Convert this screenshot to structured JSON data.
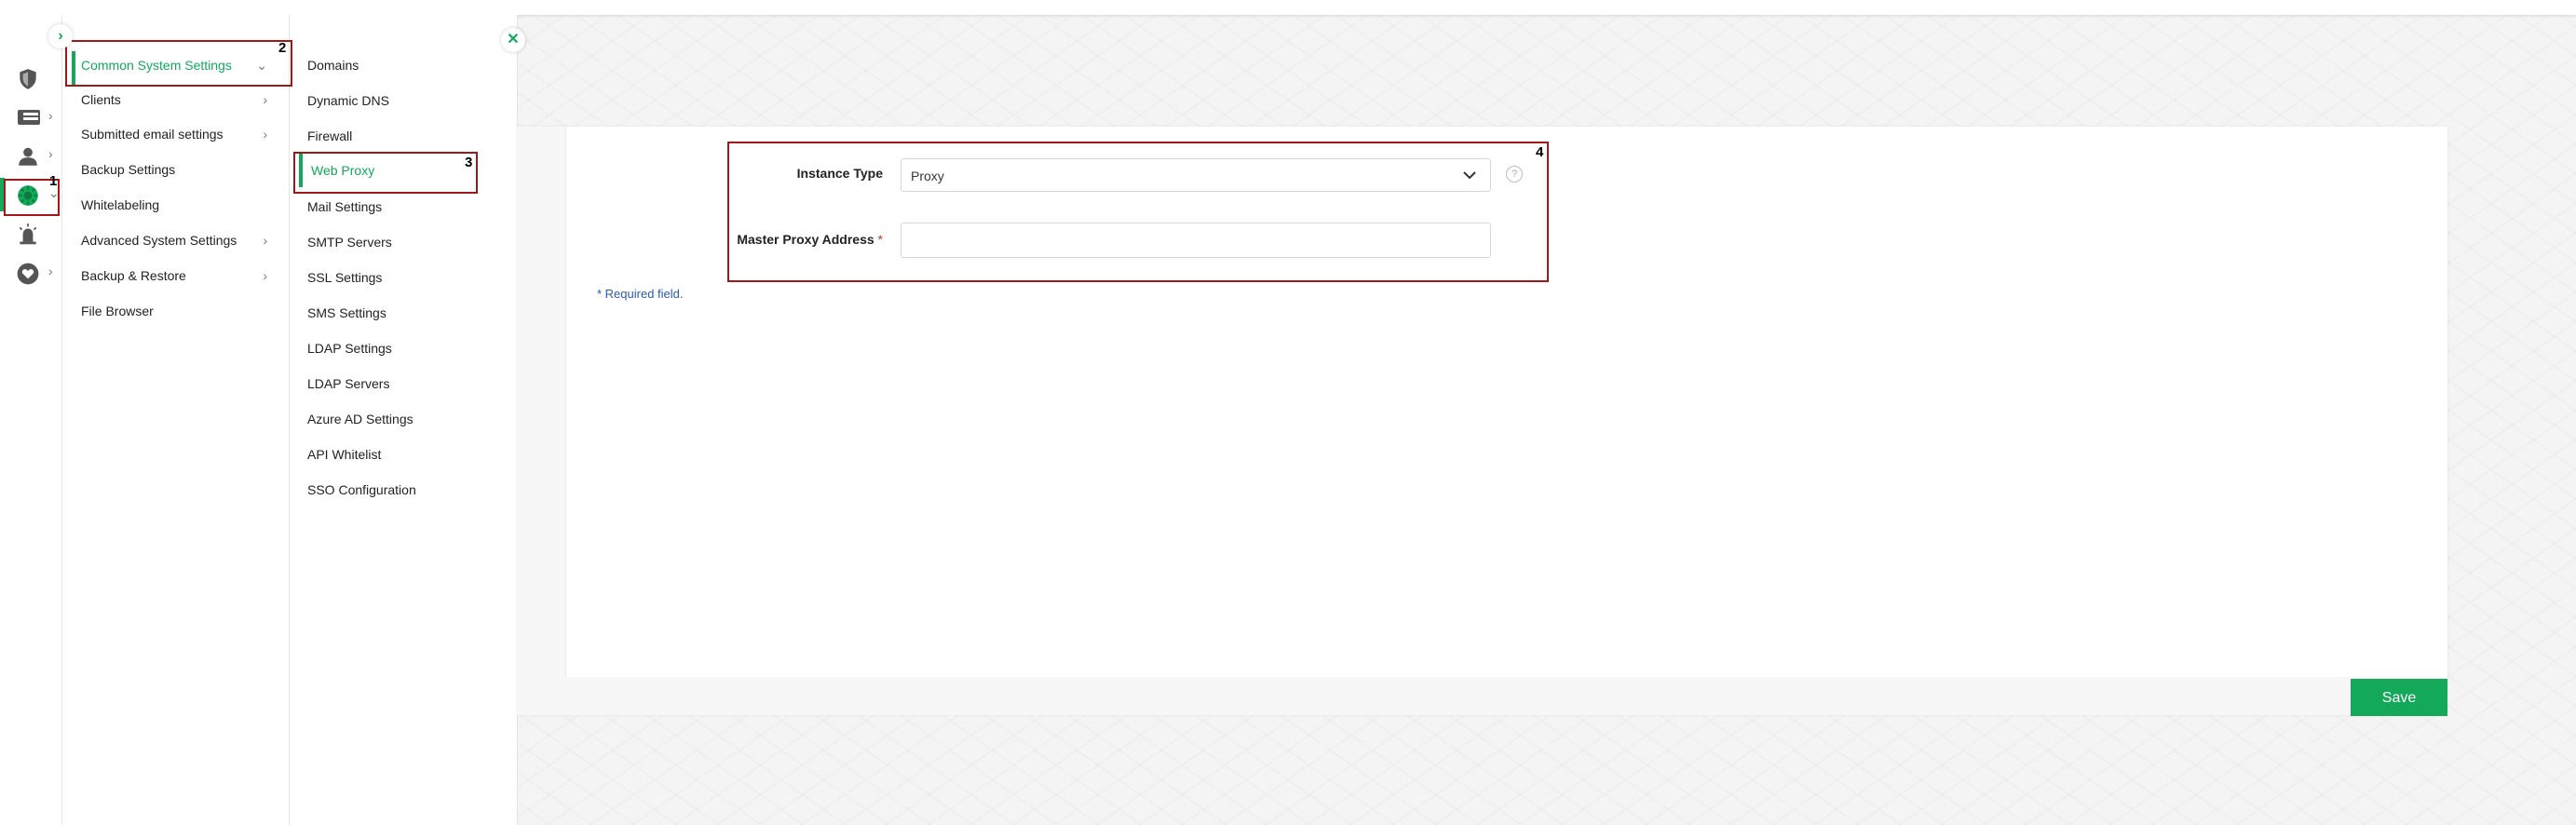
{
  "rail": {
    "toggle_icon": "expand-icon",
    "items": [
      {
        "icon": "shield-icon"
      },
      {
        "icon": "dashboard-icon"
      },
      {
        "icon": "users-icon"
      },
      {
        "icon": "settings-gear-icon"
      },
      {
        "icon": "alert-icon"
      },
      {
        "icon": "heart-icon"
      }
    ]
  },
  "menu1": {
    "items": [
      {
        "label": "Common System Settings",
        "arrow": "⌄"
      },
      {
        "label": "Clients",
        "arrow": "›"
      },
      {
        "label": "Submitted email settings",
        "arrow": "›"
      },
      {
        "label": "Backup Settings",
        "arrow": ""
      },
      {
        "label": "Whitelabeling",
        "arrow": ""
      },
      {
        "label": "Advanced System Settings",
        "arrow": "›"
      },
      {
        "label": "Backup & Restore",
        "arrow": "›"
      },
      {
        "label": "File Browser",
        "arrow": ""
      }
    ]
  },
  "menu2": {
    "items": [
      {
        "label": "Domains"
      },
      {
        "label": "Dynamic DNS"
      },
      {
        "label": "Firewall"
      },
      {
        "label": "Web Proxy"
      },
      {
        "label": "Mail Settings"
      },
      {
        "label": "SMTP Servers"
      },
      {
        "label": "SSL Settings"
      },
      {
        "label": "SMS Settings"
      },
      {
        "label": "LDAP Settings"
      },
      {
        "label": "LDAP Servers"
      },
      {
        "label": "Azure AD Settings"
      },
      {
        "label": "API Whitelist"
      },
      {
        "label": "SSO Configuration"
      }
    ]
  },
  "form": {
    "instance_type_label": "Instance Type",
    "instance_type_value": "Proxy",
    "help": "?",
    "master_proxy_label": "Master Proxy Address",
    "required_marker": "*",
    "master_proxy_value": "",
    "required_note": "* Required field."
  },
  "footer": {
    "save_label": "Save"
  },
  "annotations": [
    "1",
    "2",
    "3",
    "4"
  ],
  "colors": {
    "accent": "#13a85a",
    "annotation": "#a01818",
    "note": "#2c5ba8"
  }
}
